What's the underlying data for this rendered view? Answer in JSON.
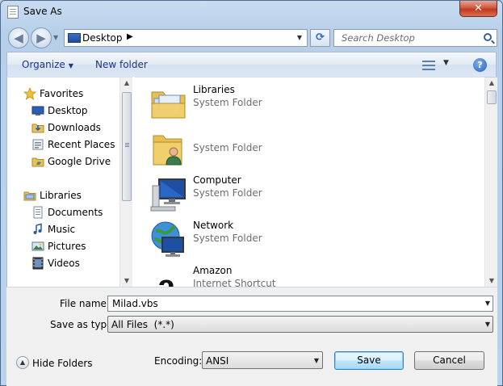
{
  "window": {
    "title": "Save As",
    "close_label": "✕"
  },
  "nav": {
    "back": "◀",
    "forward": "▶",
    "history_caret": "▼"
  },
  "address": {
    "location": "Desktop",
    "separator": "▶",
    "caret": "▼"
  },
  "refresh": {
    "glyph": "⟳"
  },
  "search": {
    "placeholder": "Search Desktop"
  },
  "toolbar": {
    "organize": "Organize",
    "organize_caret": "▼",
    "new_folder": "New folder",
    "view_caret": "▼",
    "help": "?"
  },
  "sidebar": {
    "favorites": [
      {
        "label": "Favorites",
        "icon": "star-icon"
      },
      {
        "label": "Desktop",
        "icon": "desktop-icon"
      },
      {
        "label": "Downloads",
        "icon": "downloads-icon"
      },
      {
        "label": "Recent Places",
        "icon": "recent-places-icon"
      },
      {
        "label": "Google Drive",
        "icon": "google-drive-icon"
      }
    ],
    "libraries": [
      {
        "label": "Libraries",
        "icon": "libraries-icon"
      },
      {
        "label": "Documents",
        "icon": "documents-icon"
      },
      {
        "label": "Music",
        "icon": "music-icon"
      },
      {
        "label": "Pictures",
        "icon": "pictures-icon"
      },
      {
        "label": "Videos",
        "icon": "videos-icon"
      }
    ]
  },
  "files": [
    {
      "name": "Libraries",
      "type": "System Folder",
      "icon": "libraries-folder-icon"
    },
    {
      "name": "",
      "type": "System Folder",
      "icon": "user-folder-icon"
    },
    {
      "name": "Computer",
      "type": "System Folder",
      "icon": "computer-icon"
    },
    {
      "name": "Network",
      "type": "System Folder",
      "icon": "network-icon"
    },
    {
      "name": "Amazon",
      "type": "Internet Shortcut",
      "icon": "amazon-icon"
    }
  ],
  "form": {
    "file_name_label": "File name:",
    "file_name_value": "Milad.vbs",
    "save_type_label": "Save as type:",
    "save_type_value": "All Files  (*.*)",
    "encoding_label": "Encoding:",
    "encoding_value": "ANSI",
    "caret": "▼"
  },
  "footer": {
    "hide_folders": "Hide Folders",
    "hide_glyph": "▲",
    "save": "Save",
    "cancel": "Cancel"
  },
  "colors": {
    "accent": "#1e3287",
    "window_frame": "#b9d1ea",
    "close_red": "#c0391f"
  }
}
